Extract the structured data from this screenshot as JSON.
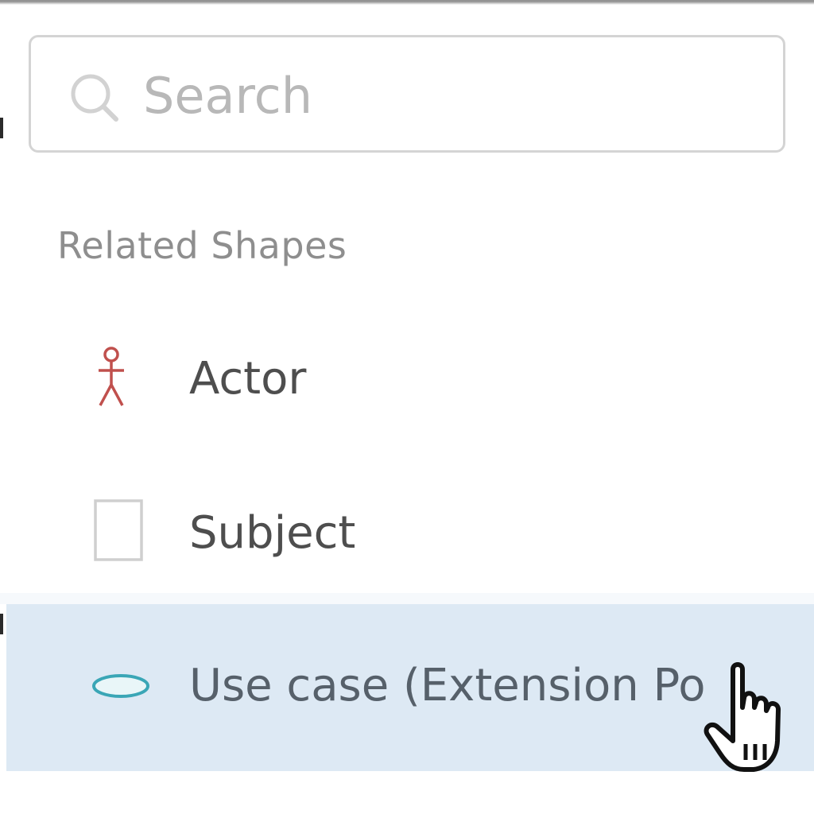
{
  "search": {
    "placeholder": "Search",
    "value": ""
  },
  "related_shapes": {
    "title": "Related Shapes",
    "items": [
      {
        "label": "Actor",
        "icon": "actor-stick-figure-icon",
        "icon_color": "#c0504d",
        "selected": false
      },
      {
        "label": "Subject",
        "icon": "subject-rectangle-icon",
        "icon_color": "#cfcfcf",
        "selected": false
      },
      {
        "label": "Use case (Extension Po",
        "icon": "use-case-ellipse-icon",
        "icon_color": "#3aa6b6",
        "selected": true
      }
    ]
  },
  "colors": {
    "selected_row_bg": "#dde9f4",
    "label_text": "#4e4e4e",
    "section_title": "#8e8e8e",
    "search_border": "#d4d4d4",
    "placeholder": "#b8b8b8"
  },
  "cursor": {
    "type": "hand-pointer"
  }
}
